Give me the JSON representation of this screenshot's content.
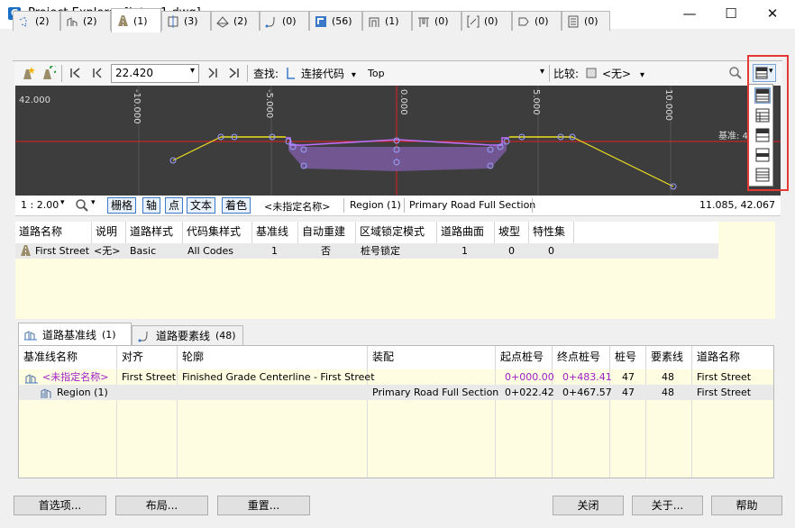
{
  "window": {
    "title": "Project Explorer [Intro-1.dwg]",
    "app_icon_letter": "C",
    "minimize": "—",
    "maximize": "☐",
    "close": "✕"
  },
  "tabs": [
    {
      "label": "(2)"
    },
    {
      "label": "(2)"
    },
    {
      "label": "(1)"
    },
    {
      "label": "(3)"
    },
    {
      "label": "(2)"
    },
    {
      "label": "(0)"
    },
    {
      "label": "(56)"
    },
    {
      "label": "(1)"
    },
    {
      "label": "(0)"
    },
    {
      "label": "(0)"
    },
    {
      "label": "(0)"
    },
    {
      "label": "(0)"
    }
  ],
  "toolbar": {
    "station_value": "22.420",
    "find_label": "查找:",
    "find_value": "连接代码",
    "find_target": "Top",
    "compare_label": "比较:",
    "compare_value": "<无>"
  },
  "preview": {
    "y_label": "42.000",
    "x_ticks": [
      "-10.000",
      "-5.000",
      "0.000",
      "5.000",
      "10.000"
    ],
    "baseline_label": "基准: 4("
  },
  "statusbar": {
    "scale": "1 : 2.00",
    "grid": "栅格",
    "axis": "轴",
    "point": "点",
    "text": "文本",
    "color": "着色",
    "name": "<未指定名称>",
    "region": "Region (1)",
    "assembly": "Primary Road Full Section",
    "coords": "11.085, 42.067"
  },
  "corridor_grid": {
    "headers": [
      "道路名称",
      "说明",
      "道路样式",
      "代码集样式",
      "基准线",
      "自动重建",
      "区域锁定模式",
      "道路曲面",
      "坡型",
      "特性集"
    ],
    "rows": [
      [
        "First Street",
        "<无>",
        "Basic",
        "All Codes",
        "1",
        "否",
        "桩号锁定",
        "1",
        "0",
        "0"
      ]
    ]
  },
  "lower_tabs": {
    "baselines_label": "道路基准线",
    "baselines_count": "(1)",
    "features_label": "道路要素线",
    "features_count": "(48)"
  },
  "baseline_grid": {
    "headers": [
      "基准线名称",
      "对齐",
      "轮廓",
      "装配",
      "起点桩号",
      "终点桩号",
      "桩号",
      "要素线",
      "道路名称"
    ],
    "rows": [
      [
        "<未指定名称>",
        "First Street",
        "Finished Grade Centerline - First Street",
        "",
        "0+000.00",
        "0+483.41",
        "47",
        "48",
        "First Street"
      ],
      [
        "Region (1)",
        "",
        "",
        "Primary Road Full Section",
        "0+022.42",
        "0+467.57",
        "47",
        "48",
        "First Street"
      ]
    ]
  },
  "buttons": {
    "prefs": "首选项...",
    "layout": "布局...",
    "reset": "重置...",
    "close": "关闭",
    "about": "关于...",
    "help": "帮助"
  },
  "colors": {
    "accent_blue": "#3c78c8",
    "highlight_red": "#e53935",
    "grid_yellow": "#fffde1",
    "preview_bg": "#3d3d3d",
    "start_station_purple": "#a020c8"
  }
}
